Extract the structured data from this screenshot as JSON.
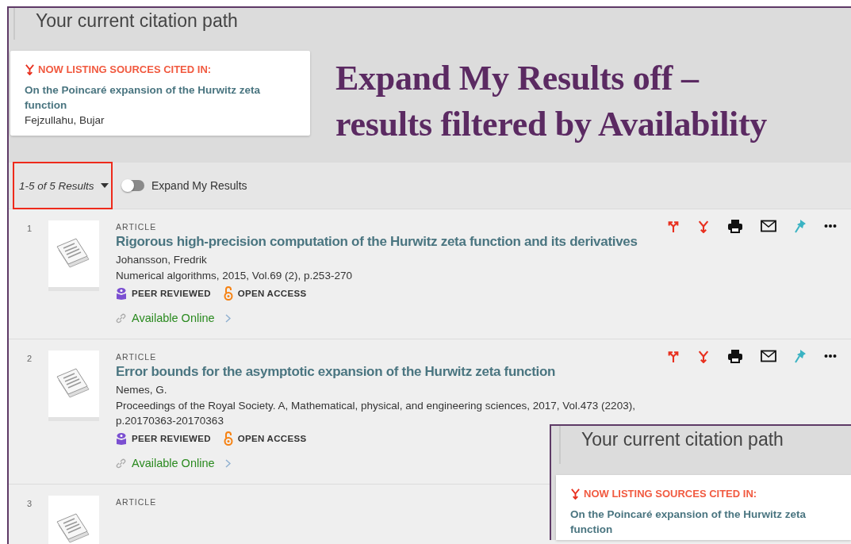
{
  "header": {
    "title": "Your current citation path",
    "card": {
      "label": "NOW LISTING SOURCES CITED IN:",
      "title": "On the Poincaré expansion of the Hurwitz zeta function",
      "author": "Fejzullahu, Bujar"
    }
  },
  "annotation": {
    "lines": [
      "Expand My Results off –",
      "results filtered by Availability"
    ]
  },
  "results_bar": {
    "count": "1-5 of 5 Results",
    "highlighted": true,
    "toggle": {
      "label": "Expand My Results",
      "on": false
    }
  },
  "results": [
    {
      "number": "1",
      "type": "ARTICLE",
      "title": "Rigorous high-precision computation of the Hurwitz zeta function and its derivatives",
      "author": "Johansson, Fredrik",
      "source": [
        "Numerical algorithms, 2015, Vol.69 (2), p.253-270"
      ],
      "badges": [
        {
          "kind": "peer",
          "label": "PEER REVIEWED"
        },
        {
          "kind": "open",
          "label": "OPEN ACCESS"
        }
      ],
      "availability": "Available Online"
    },
    {
      "number": "2",
      "type": "ARTICLE",
      "title": "Error bounds for the asymptotic expansion of the Hurwitz zeta function",
      "author": "Nemes, G.",
      "source": [
        "Proceedings of the Royal Society. A, Mathematical, physical, and engineering sciences, 2017, Vol.473 (2203),",
        "p.20170363-20170363"
      ],
      "badges": [
        {
          "kind": "peer",
          "label": "PEER REVIEWED"
        },
        {
          "kind": "open",
          "label": "OPEN ACCESS"
        }
      ],
      "availability": "Available Online"
    },
    {
      "number": "3",
      "type": "ARTICLE"
    }
  ],
  "overlay": {
    "title": "Your current citation path",
    "card": {
      "label": "NOW LISTING SOURCES CITED IN:",
      "title": "On the Poincaré expansion of the Hurwitz zeta function"
    }
  }
}
